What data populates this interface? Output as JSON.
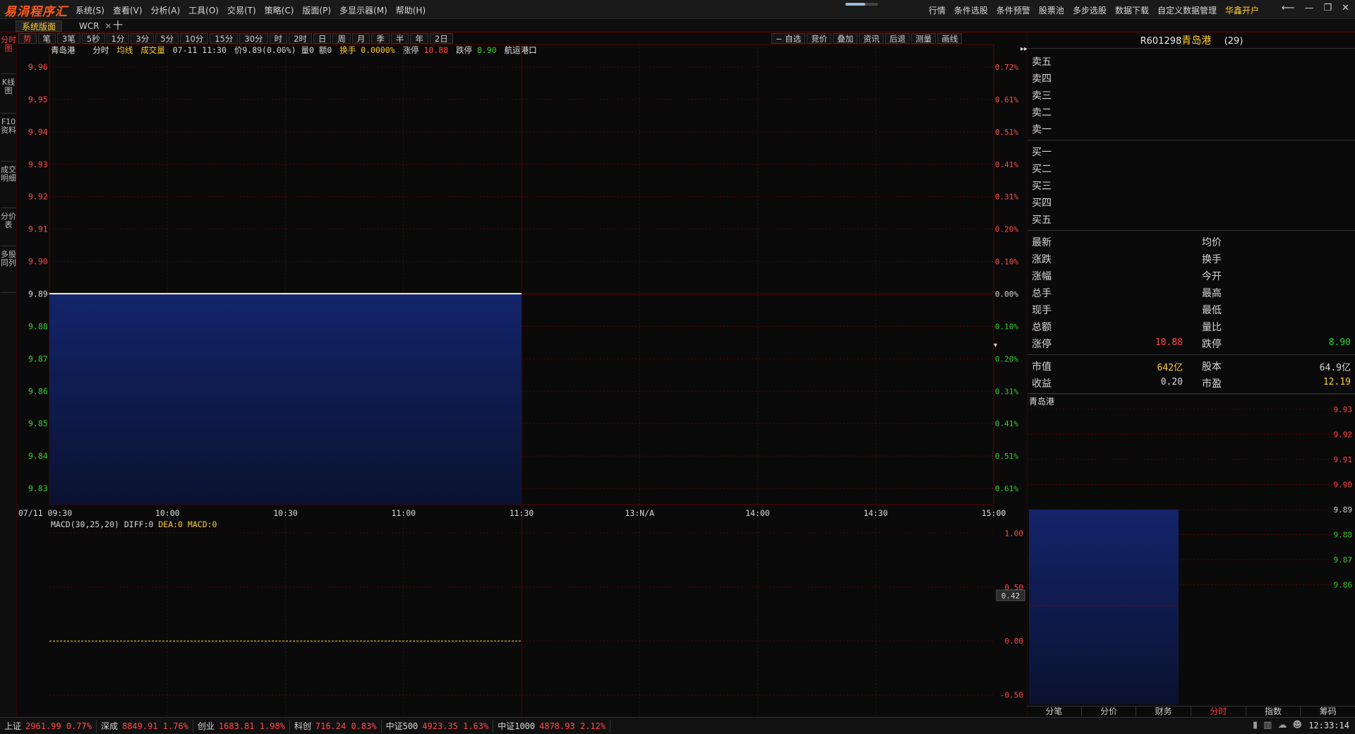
{
  "app": {
    "logo": "易涓程序汇",
    "menu": [
      "系统(S)",
      "查看(V)",
      "分析(A)",
      "工具(O)",
      "交易(T)",
      "策略(C)",
      "版面(P)",
      "多显示器(M)",
      "帮助(H)"
    ],
    "right_menu": [
      "行情",
      "条件选股",
      "条件预警",
      "股票池",
      "多步选股",
      "数据下载",
      "自定义数据管理"
    ],
    "open_account": "华鑫开户",
    "win": {
      "back": "⟵",
      "min": "—",
      "max": "❐",
      "close": "✕"
    }
  },
  "tabs": {
    "active": "系统版面",
    "second": "WCR",
    "close": "✕",
    "add": "十"
  },
  "sidebar": [
    "分时图",
    "K线图",
    "F10资料",
    "成交明细",
    "分价表",
    "多股同列"
  ],
  "periods": [
    "势",
    "笔",
    "3笔",
    "5秒",
    "1分",
    "3分",
    "5分",
    "10分",
    "15分",
    "30分",
    "时",
    "2时",
    "日",
    "周",
    "月",
    "季",
    "半",
    "年",
    "2日"
  ],
  "toolbar": [
    "− 自选",
    "竞价",
    "叠加",
    "资讯",
    "后退",
    "测量",
    "画线"
  ],
  "info": {
    "name": "青岛港",
    "mode": "分时",
    "avg": "均线",
    "vol": "成交量",
    "datetime": "07-11 11:30",
    "price": "价9.89(0.00%)",
    "volume": "量0",
    "amount": "额0",
    "turnover_label": "换手",
    "turnover": "0.0000%",
    "limit_up_label": "涨停",
    "limit_up": "10.88",
    "limit_down_label": "跌停",
    "limit_down": "8.90",
    "industry": "航运港口"
  },
  "chart_data": {
    "type": "line",
    "title": "青岛港 分时",
    "x_ticks": [
      "07/11 09:30",
      "10:00",
      "10:30",
      "11:00",
      "11:30",
      "13:N/A",
      "14:00",
      "14:30",
      "15:00"
    ],
    "y_left": [
      "9.96",
      "9.95",
      "9.94",
      "9.93",
      "9.92",
      "9.91",
      "9.90",
      "9.89",
      "9.88",
      "9.87",
      "9.86",
      "9.85",
      "9.84",
      "9.83"
    ],
    "y_right": [
      "0.72%",
      "0.61%",
      "0.51%",
      "0.41%",
      "0.31%",
      "0.20%",
      "0.10%",
      "0.00%",
      "0.10%",
      "0.20%",
      "0.31%",
      "0.41%",
      "0.51%",
      "0.61%"
    ],
    "prev_close": 9.89,
    "ylim": [
      9.825,
      9.965
    ],
    "series": [
      {
        "name": "价",
        "x": [
          "09:30",
          "11:30"
        ],
        "values": [
          9.89,
          9.89
        ]
      },
      {
        "name": "均线",
        "x": [
          "09:30",
          "11:30"
        ],
        "values": [
          9.89,
          9.89
        ]
      }
    ]
  },
  "macd": {
    "label": "MACD(30,25,20)",
    "diff": "DIFF:0",
    "dea": "DEA:0",
    "macd": "MACD:0",
    "y_ticks": [
      "1.00",
      "0.50",
      "0.00",
      "-0.50"
    ],
    "cursor": "0.42",
    "ylim": [
      -0.6,
      1.1
    ],
    "values": [
      0,
      0
    ]
  },
  "quote": {
    "code": "R601298",
    "name": "青岛港",
    "count": "(29)",
    "sell": [
      "卖五",
      "卖四",
      "卖三",
      "卖二",
      "卖一"
    ],
    "buy": [
      "买一",
      "买二",
      "买三",
      "买四",
      "买五"
    ],
    "stats_left": [
      "最新",
      "涨跌",
      "涨幅",
      "总手",
      "现手",
      "总额",
      "涨停"
    ],
    "stats_right": [
      "均价",
      "换手",
      "今开",
      "最高",
      "最低",
      "量比",
      "跌停"
    ],
    "limit_up": "10.88",
    "limit_down": "8.90",
    "mktcap_label": "市值",
    "mktcap": "642亿",
    "shares_label": "股本",
    "shares": "64.9亿",
    "eps_label": "收益",
    "eps": "0.20",
    "pe_label": "市盈",
    "pe": "12.19"
  },
  "mini": {
    "title": "青岛港",
    "y_ticks": [
      "9.93",
      "9.92",
      "9.91",
      "9.90",
      "9.89",
      "9.88",
      "9.87",
      "9.86"
    ]
  },
  "right_tabs": [
    "分笔",
    "分价",
    "财务",
    "分时",
    "指数",
    "筹码"
  ],
  "status": {
    "indices": [
      {
        "name": "上证",
        "value": "2961.99",
        "pct": "0.77%"
      },
      {
        "name": "深成",
        "value": "8849.91",
        "pct": "1.76%"
      },
      {
        "name": "创业",
        "value": "1683.81",
        "pct": "1.98%"
      },
      {
        "name": "科创",
        "value": "716.24",
        "pct": "0.83%"
      },
      {
        "name": "中证500",
        "value": "4923.35",
        "pct": "1.63%"
      },
      {
        "name": "中证1000",
        "value": "4878.93",
        "pct": "2.12%"
      }
    ],
    "clock": "12:33:14"
  },
  "colors": {
    "up": "#ff4a4a",
    "down": "#33cc33",
    "neutral": "#d8d8d8",
    "fill": "#10205a",
    "grid": "#5a0000",
    "accent": "#ffcc33"
  }
}
